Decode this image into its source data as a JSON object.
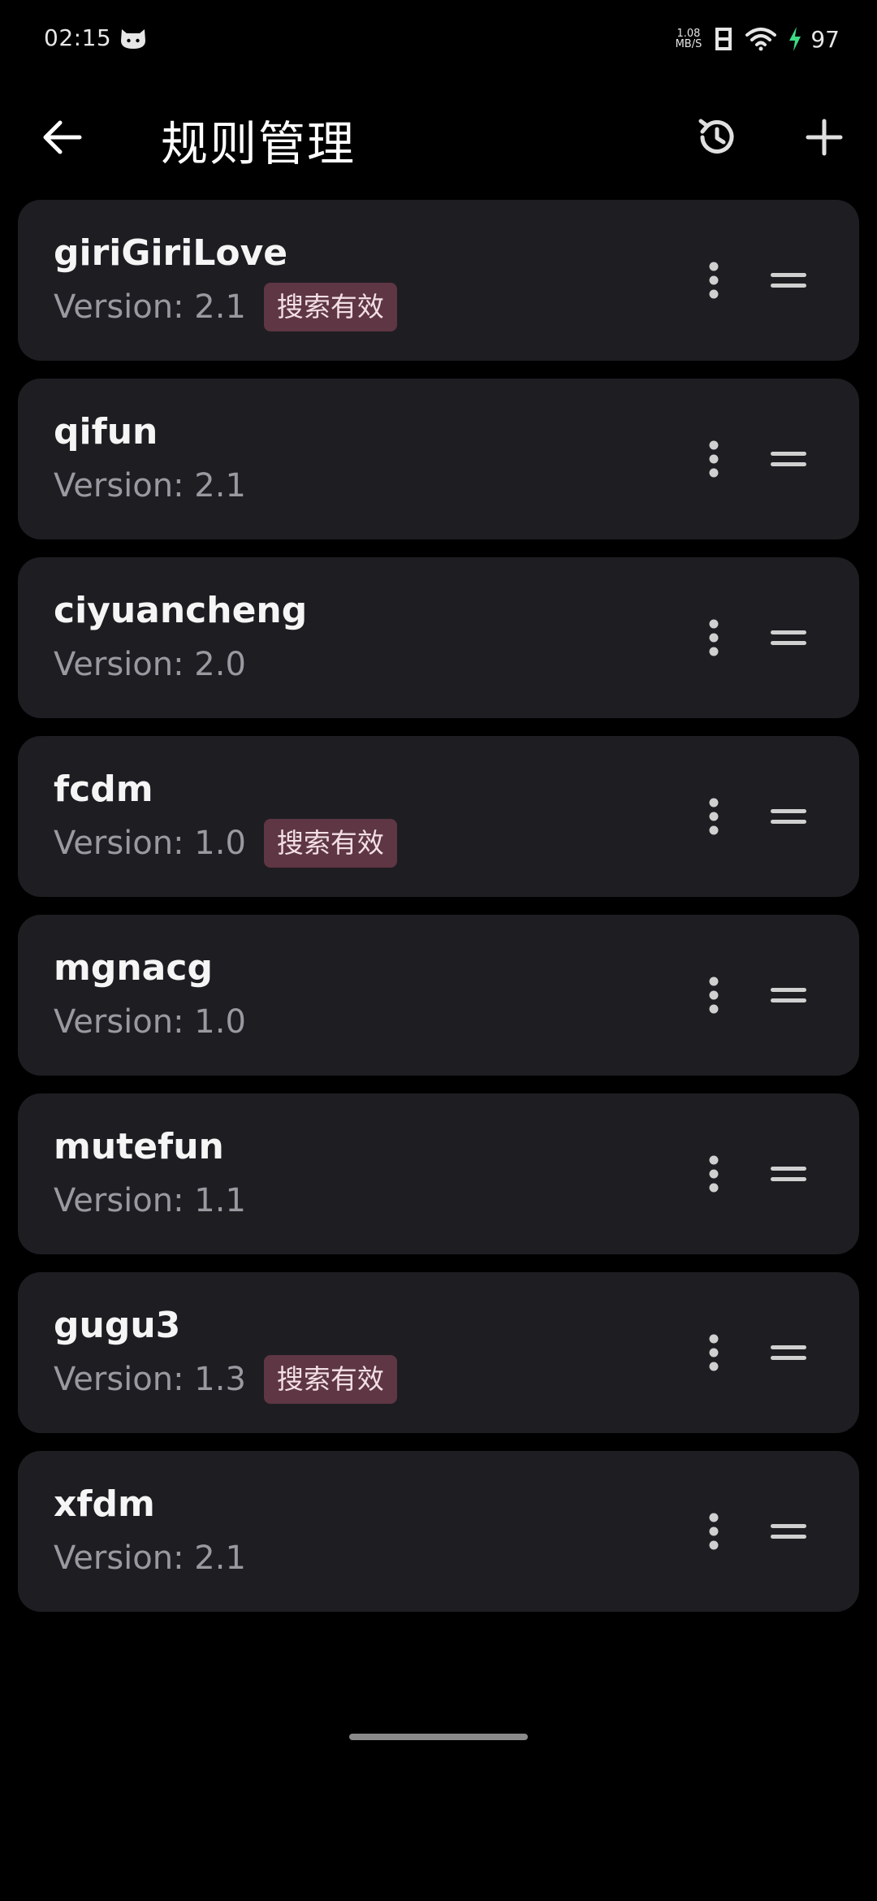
{
  "status_bar": {
    "time": "02:15",
    "net_speed_value": "1.08",
    "net_speed_unit": "MB/S",
    "battery": "97",
    "icons": [
      "cat-app-icon",
      "sim-icon",
      "wifi-icon",
      "charging-icon"
    ]
  },
  "app_bar": {
    "title": "规则管理",
    "icons": [
      "back-arrow-icon",
      "history-icon",
      "plus-icon"
    ]
  },
  "rules": [
    {
      "name": "giriGiriLove",
      "version": "Version: 2.1",
      "badge": "搜索有效"
    },
    {
      "name": "qifun",
      "version": "Version: 2.1",
      "badge": ""
    },
    {
      "name": "ciyuancheng",
      "version": "Version: 2.0",
      "badge": ""
    },
    {
      "name": "fcdm",
      "version": "Version: 1.0",
      "badge": "搜索有效"
    },
    {
      "name": "mgnacg",
      "version": "Version: 1.0",
      "badge": ""
    },
    {
      "name": "mutefun",
      "version": "Version: 1.1",
      "badge": ""
    },
    {
      "name": "gugu3",
      "version": "Version: 1.3",
      "badge": "搜索有效"
    },
    {
      "name": "xfdm",
      "version": "Version: 2.1",
      "badge": ""
    }
  ],
  "colors": {
    "background": "#000000",
    "card": "#1e1d22",
    "badge": "#5e3644",
    "badge_text": "#f2dfe4",
    "secondary_text": "#9a99a0",
    "charging": "#3ddc84"
  }
}
